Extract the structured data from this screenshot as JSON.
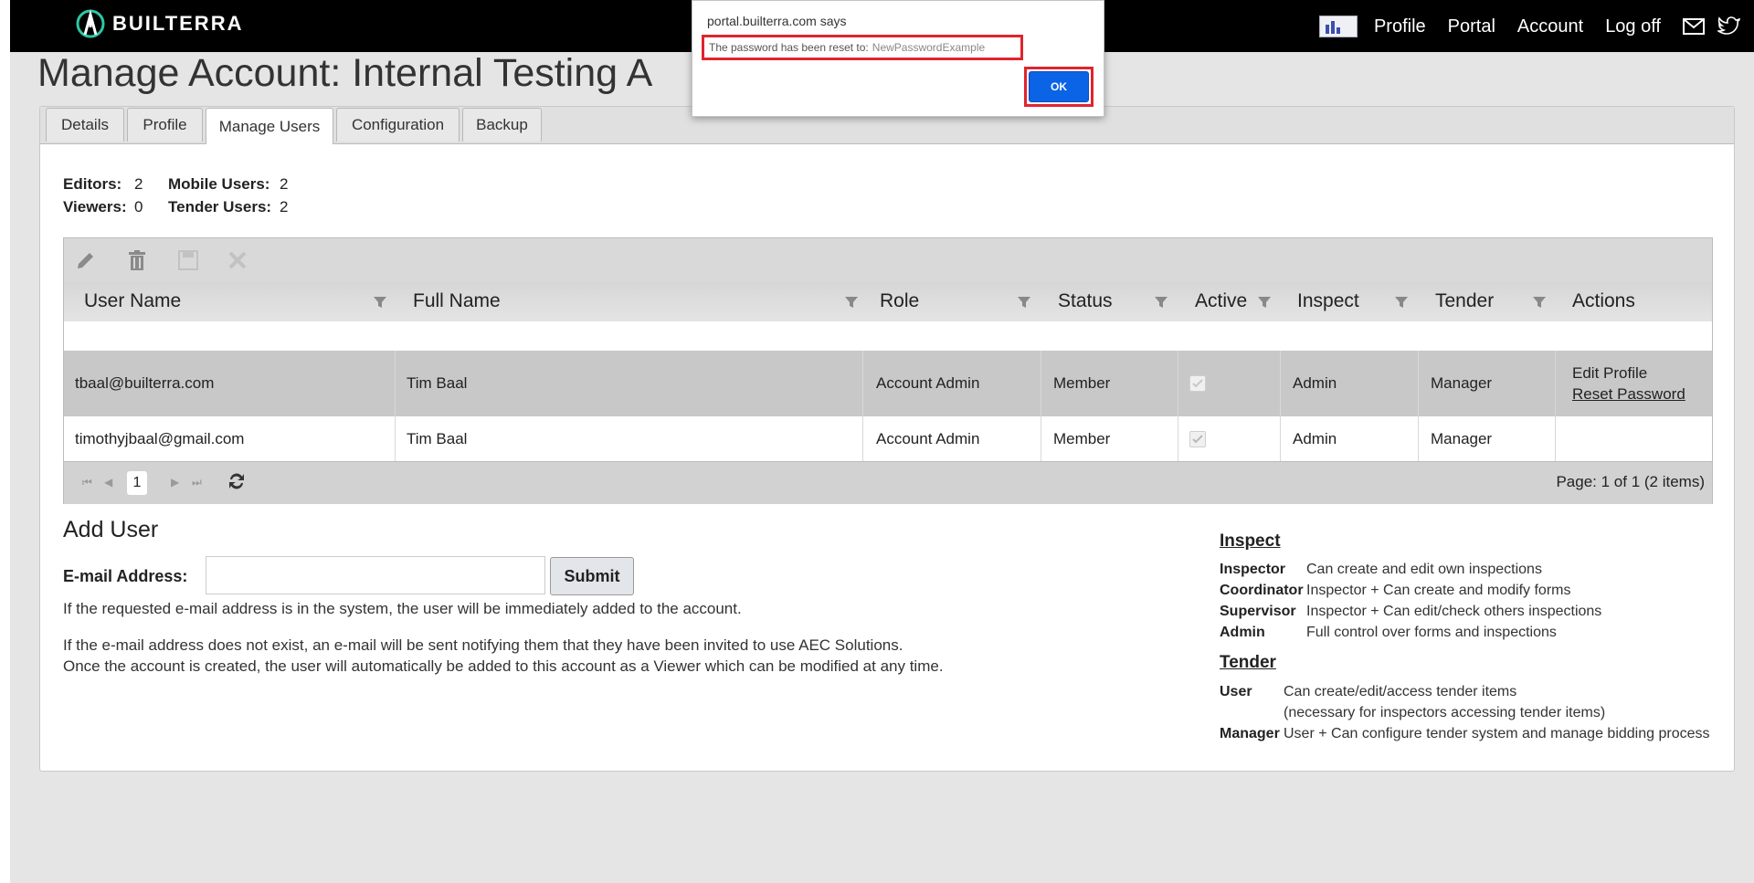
{
  "brand": {
    "name": "BUILTERRA"
  },
  "nav": {
    "items": [
      "Profile",
      "Portal",
      "Account",
      "Log off"
    ],
    "icons": [
      "mail-icon",
      "twitter-icon"
    ]
  },
  "page": {
    "title": "Manage Account: Internal Testing A"
  },
  "tabs": [
    "Details",
    "Profile",
    "Manage Users",
    "Configuration",
    "Backup"
  ],
  "active_tab": "Manage Users",
  "stats": {
    "editors_label": "Editors:",
    "editors": "2",
    "viewers_label": "Viewers:",
    "viewers": "0",
    "mobile_label": "Mobile Users:",
    "mobile": "2",
    "tender_label": "Tender Users:",
    "tender": "2"
  },
  "grid": {
    "toolbar_icons": [
      "edit-icon",
      "delete-icon",
      "save-icon",
      "cancel-icon"
    ],
    "columns": [
      "User Name",
      "Full Name",
      "Role",
      "Status",
      "Active",
      "Inspect",
      "Tender",
      "Actions"
    ],
    "rows": [
      {
        "user": "tbaal@builterra.com",
        "full": "Tim Baal",
        "role": "Account Admin",
        "status": "Member",
        "active": true,
        "inspect": "Admin",
        "tender": "Manager",
        "action1": "Edit Profile",
        "action2": "Reset Password"
      },
      {
        "user": "timothyjbaal@gmail.com",
        "full": "Tim Baal",
        "role": "Account Admin",
        "status": "Member",
        "active": true,
        "inspect": "Admin",
        "tender": "Manager",
        "action1": "",
        "action2": ""
      }
    ],
    "pager": {
      "current_page": "1",
      "info": "Page: 1 of 1 (2 items)"
    }
  },
  "add_user": {
    "heading": "Add User",
    "email_label": "E-mail Address:",
    "email_value": "",
    "submit_label": "Submit",
    "note1": "If the requested e-mail address is in the system, the user will be immediately added to the account.",
    "note2": "If the e-mail address does not exist, an e-mail will be sent notifying them that they have been invited to use AEC Solutions.",
    "note3": "Once the account is created, the user will automatically be added to this account as a Viewer which can be modified at any time."
  },
  "legend": {
    "inspect_heading": "Inspect",
    "inspect": [
      {
        "role": "Inspector",
        "desc": "Can create and edit own inspections"
      },
      {
        "role": "Coordinator",
        "desc": "Inspector + Can create and modify forms"
      },
      {
        "role": "Supervisor",
        "desc": "Inspector + Can edit/check others inspections"
      },
      {
        "role": "Admin",
        "desc": "Full control over forms and inspections"
      }
    ],
    "tender_heading": "Tender",
    "tender": [
      {
        "role": "User",
        "desc": "Can create/edit/access tender items",
        "desc2": "(necessary for inspectors accessing tender items)"
      },
      {
        "role": "Manager",
        "desc": "User + Can configure tender system and manage bidding process"
      }
    ]
  },
  "dialog": {
    "title": "portal.builterra.com says",
    "message": "The password has been reset to:",
    "password": "NewPasswordExample",
    "ok_label": "OK"
  },
  "colors": {
    "header_bg": "#000000",
    "highlight_red": "#e0242e",
    "ok_blue": "#0b63e5"
  }
}
